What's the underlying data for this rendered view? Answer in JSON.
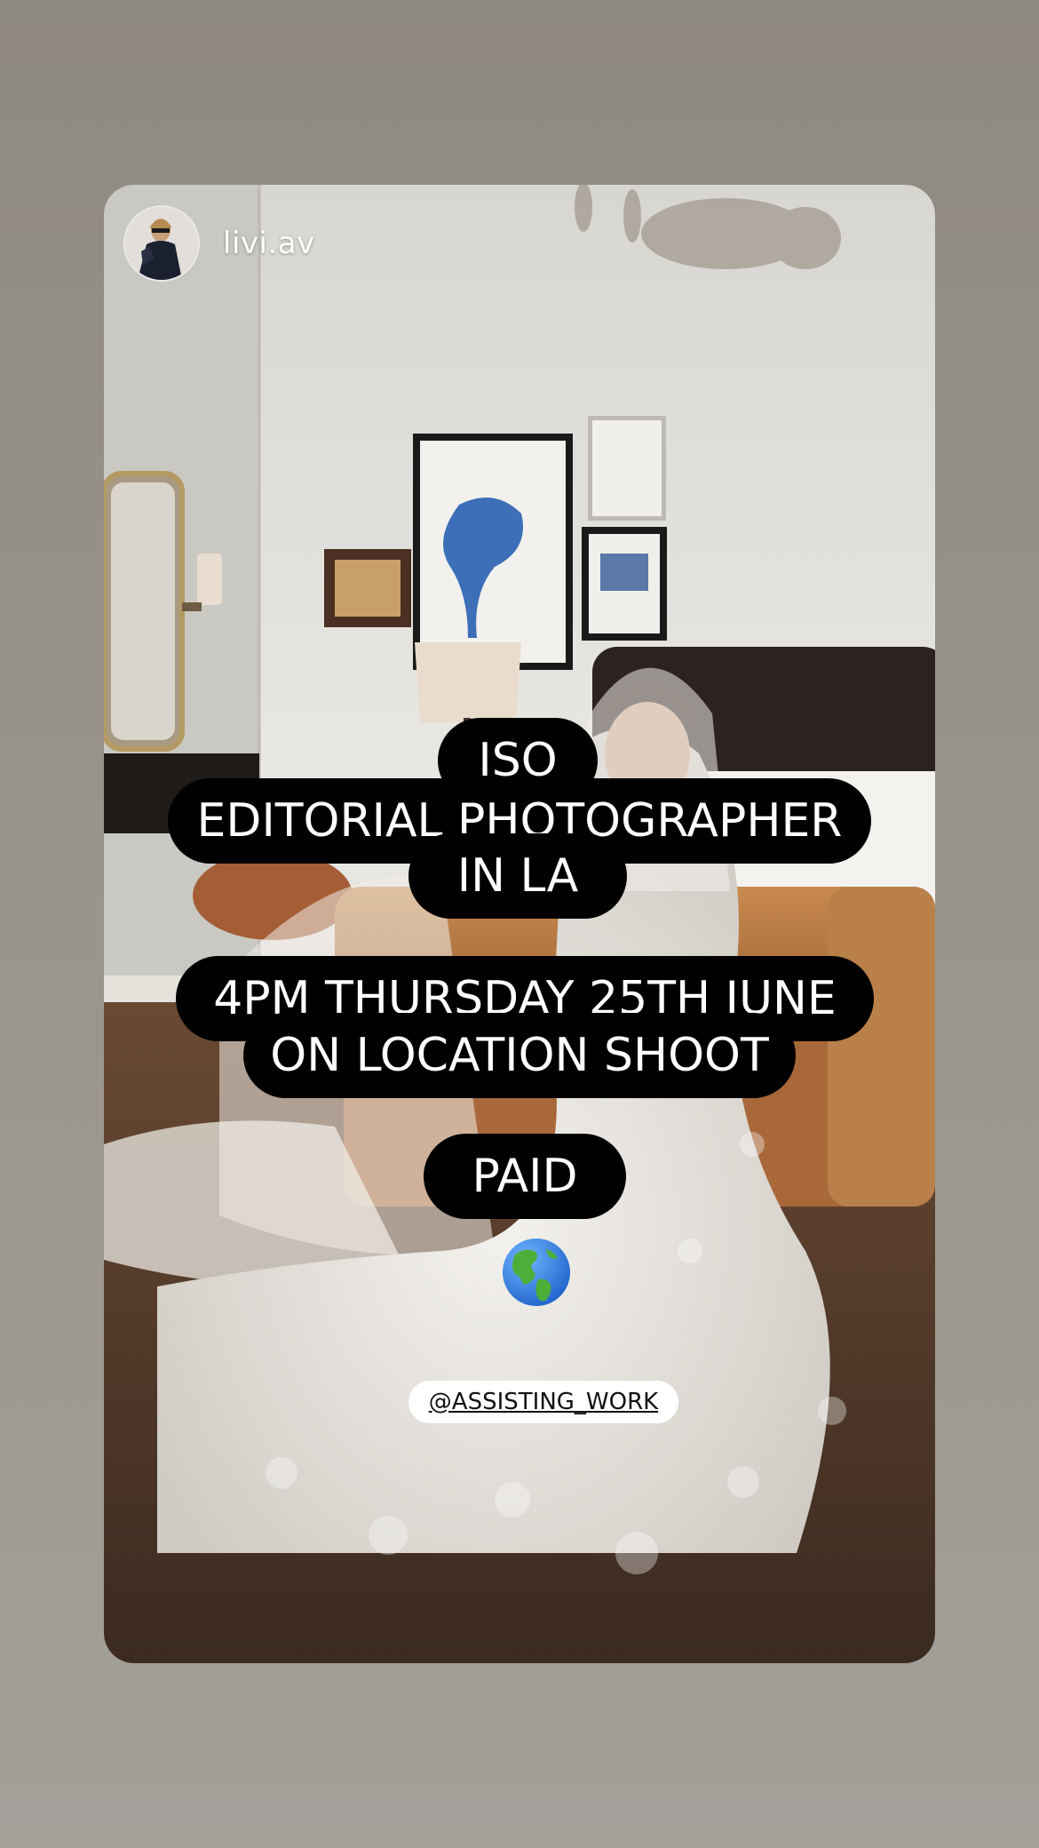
{
  "story": {
    "username": "livi.av"
  },
  "overlay": {
    "line1": "ISO",
    "line2": "EDITORIAL PHOTOGRAPHER",
    "line3": "IN LA",
    "line4": "4PM THURSDAY 25TH JUNE",
    "line5": "ON LOCATION SHOOT",
    "line6": "PAID",
    "emoji_icon": "globe-americas-icon",
    "mention": "@ASSISTING_WORK"
  },
  "colors": {
    "page_background": "#99958c",
    "pill_background": "#000000",
    "pill_text": "#ffffff",
    "mention_background": "#ffffff"
  }
}
